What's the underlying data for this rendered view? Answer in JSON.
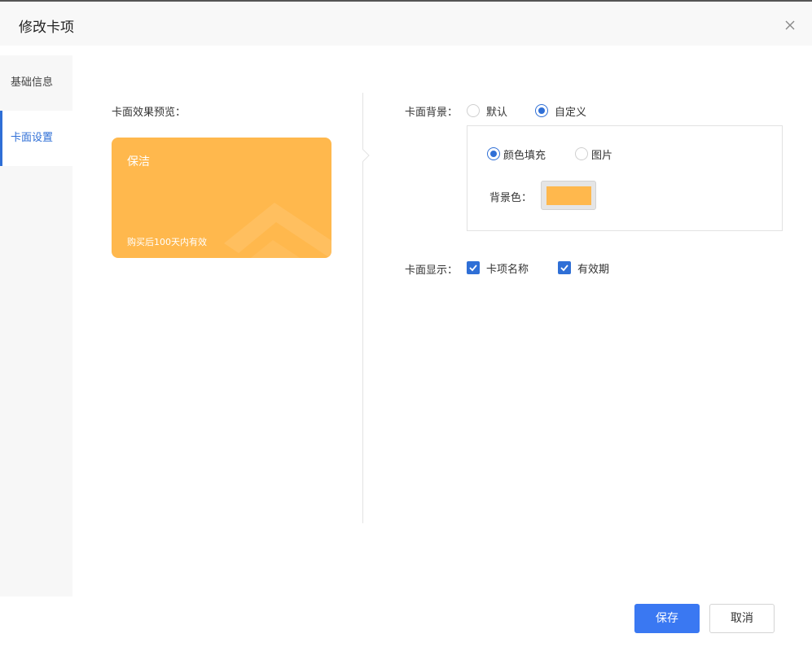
{
  "dialog": {
    "title": "修改卡项"
  },
  "sidebar": {
    "items": [
      {
        "label": "基础信息"
      },
      {
        "label": "卡面设置"
      }
    ]
  },
  "preview": {
    "label": "卡面效果预览：",
    "card": {
      "name": "保洁",
      "validity": "购买后100天内有效",
      "color": "#ffb84d"
    }
  },
  "background": {
    "label": "卡面背景：",
    "options": [
      {
        "label": "默认",
        "checked": false
      },
      {
        "label": "自定义",
        "checked": true
      }
    ],
    "sub_options": [
      {
        "label": "颜色填充",
        "checked": true
      },
      {
        "label": "图片",
        "checked": false
      }
    ],
    "color_label": "背景色：",
    "color_value": "#ffb84d"
  },
  "display": {
    "label": "卡面显示：",
    "options": [
      {
        "label": "卡项名称",
        "checked": true
      },
      {
        "label": "有效期",
        "checked": true
      }
    ]
  },
  "footer": {
    "save_label": "保存",
    "cancel_label": "取消"
  },
  "colors": {
    "accent": "#2f6fd6",
    "primary_button": "#3a78f2",
    "card": "#ffb84d"
  }
}
